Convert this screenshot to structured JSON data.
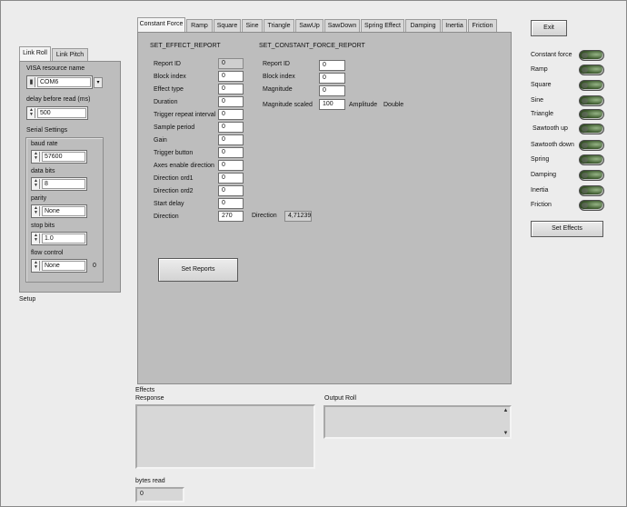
{
  "left_tabs": [
    {
      "label": "Link Roll"
    },
    {
      "label": "Link Pitch"
    }
  ],
  "link": {
    "visa_label": "VISA resource name",
    "visa_value": "COM6",
    "delay_label": "delay before read (ms)",
    "delay_value": "500",
    "serial_label": "Serial Settings",
    "baud_label": "baud rate",
    "baud_value": "57600",
    "databits_label": "data bits",
    "databits_value": "8",
    "parity_label": "parity",
    "parity_value": "None",
    "stopbits_label": "stop bits",
    "stopbits_value": "1.0",
    "flow_label": "flow control",
    "flow_value": "None",
    "flow_index": "0",
    "setup_label": "Setup"
  },
  "effect_tabs": [
    {
      "label": "Constant Force"
    },
    {
      "label": "Ramp"
    },
    {
      "label": "Square"
    },
    {
      "label": "Sine"
    },
    {
      "label": "Triangle"
    },
    {
      "label": "SawUp"
    },
    {
      "label": "SawDown"
    },
    {
      "label": "Spring Effect"
    },
    {
      "label": "Damping"
    },
    {
      "label": "Inertia"
    },
    {
      "label": "Friction"
    }
  ],
  "set_effect": {
    "title": "SET_EFFECT_REPORT",
    "fields": [
      {
        "label": "Report ID",
        "value": "0",
        "readonly": true
      },
      {
        "label": "Block index",
        "value": "0"
      },
      {
        "label": "Effect type",
        "value": "0"
      },
      {
        "label": "Duration",
        "value": "0"
      },
      {
        "label": "Trigger repeat interval",
        "value": "0"
      },
      {
        "label": "Sample period",
        "value": "0"
      },
      {
        "label": "Gain",
        "value": "0"
      },
      {
        "label": "Trigger button",
        "value": "0"
      },
      {
        "label": "Axes enable direction",
        "value": "0"
      },
      {
        "label": "Direction ord1",
        "value": "0"
      },
      {
        "label": "Direction ord2",
        "value": "0"
      },
      {
        "label": "Start delay",
        "value": "0"
      },
      {
        "label": "Direction",
        "value": "270"
      }
    ],
    "direction_out_label": "Direction",
    "direction_out_value": "4,71239"
  },
  "set_constant": {
    "title": "SET_CONSTANT_FORCE_REPORT",
    "fields": [
      {
        "label": "Report ID",
        "value": "0"
      },
      {
        "label": "Block index",
        "value": "0"
      },
      {
        "label": "Magnitude",
        "value": "0"
      },
      {
        "label": "Magnitude scaled",
        "value": "100"
      }
    ],
    "amplitude_label": "Amplitude",
    "double_label": "Double"
  },
  "set_reports_label": "Set Reports",
  "exit_label": "Exit",
  "effects_list": [
    {
      "label": "Constant force"
    },
    {
      "label": "Ramp"
    },
    {
      "label": "Square"
    },
    {
      "label": "Sine"
    },
    {
      "label": "Triangle"
    },
    {
      "label": "Sawtooth up"
    },
    {
      "label": "Sawtooth down"
    },
    {
      "label": "Spring"
    },
    {
      "label": "Damping"
    },
    {
      "label": "Inertia"
    },
    {
      "label": "Friction"
    }
  ],
  "set_effects_label": "Set Effects",
  "effects_label": "Effects",
  "response_label": "Response",
  "output_label": "Output Roll",
  "bytes_label": "bytes read",
  "bytes_value": "0",
  "colors": {
    "led_on": "#3d5a2e",
    "panel": "#bdbdbd",
    "background": "#ececec"
  }
}
